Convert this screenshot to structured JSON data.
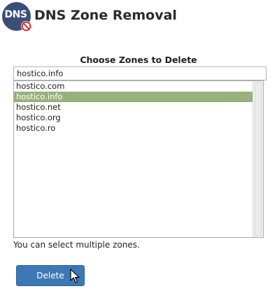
{
  "header": {
    "logo_text": "DNS",
    "title": "DNS Zone Removal"
  },
  "form": {
    "section_title": "Choose Zones to Delete",
    "selected_value": "hostico.info",
    "zones": [
      {
        "label": "hostico.com",
        "selected": false
      },
      {
        "label": "hostico.info",
        "selected": true
      },
      {
        "label": "hostico.net",
        "selected": false
      },
      {
        "label": "hostico.org",
        "selected": false
      },
      {
        "label": "hostico.ro",
        "selected": false
      }
    ],
    "hint": "You can select multiple zones.",
    "delete_label": "Delete"
  },
  "colors": {
    "selected_row": "#96b27a",
    "button": "#3d78b6",
    "logo_bg": "#3b4e78",
    "badge": "#d32f2f"
  }
}
